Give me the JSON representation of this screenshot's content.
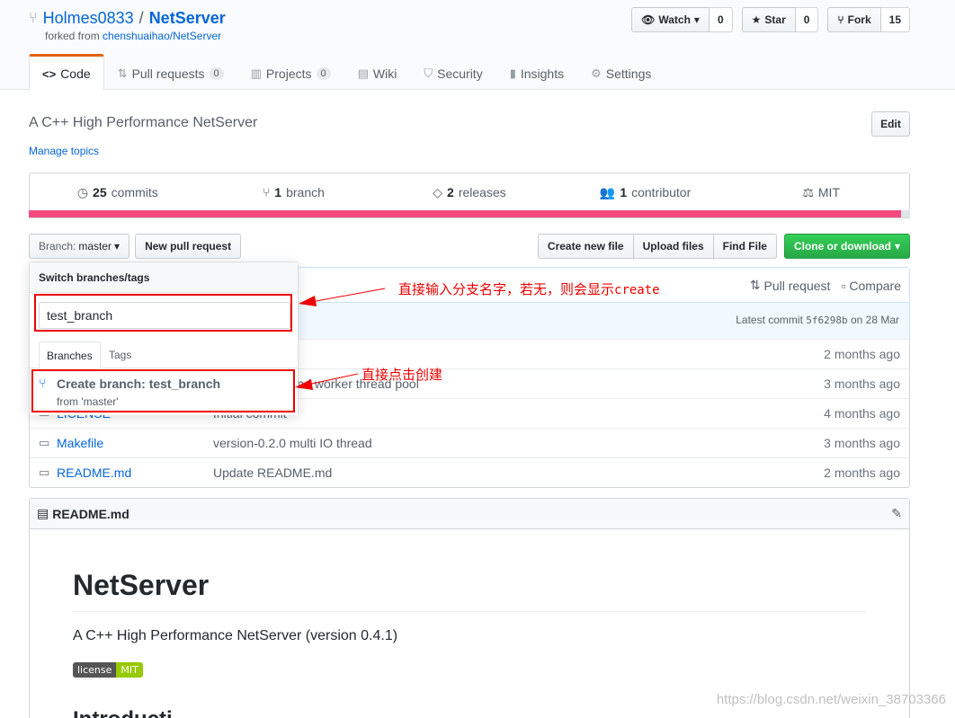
{
  "repo": {
    "owner": "Holmes0833",
    "separator": "/",
    "name": "NetServer",
    "forked_prefix": "forked from ",
    "forked_from": "chenshuaihao/NetServer"
  },
  "actions": {
    "watch": {
      "label": "Watch",
      "count": "0"
    },
    "star": {
      "label": "Star",
      "count": "0"
    },
    "fork": {
      "label": "Fork",
      "count": "15"
    }
  },
  "tabs": [
    {
      "label": "Code",
      "icon": "code-icon",
      "counter": ""
    },
    {
      "label": "Pull requests",
      "icon": "pull-request-icon",
      "counter": "0"
    },
    {
      "label": "Projects",
      "icon": "project-icon",
      "counter": "0"
    },
    {
      "label": "Wiki",
      "icon": "book-icon",
      "counter": ""
    },
    {
      "label": "Security",
      "icon": "shield-icon",
      "counter": ""
    },
    {
      "label": "Insights",
      "icon": "graph-icon",
      "counter": ""
    },
    {
      "label": "Settings",
      "icon": "gear-icon",
      "counter": ""
    }
  ],
  "description": "A C++ High Performance NetServer",
  "manage_topics": "Manage topics",
  "edit_label": "Edit",
  "summary": {
    "commits_num": "25",
    "commits_label": "commits",
    "branches_num": "1",
    "branches_label": "branch",
    "releases_num": "2",
    "releases_label": "releases",
    "contributors_num": "1",
    "contributors_label": "contributor",
    "license": "MIT"
  },
  "file_nav": {
    "branch_prefix": "Branch:",
    "branch_name": "master",
    "new_pr": "New pull request",
    "create_file": "Create new file",
    "upload_files": "Upload files",
    "find_file": "Find File",
    "clone": "Clone or download"
  },
  "commit_tease": {
    "pull_request": "Pull request",
    "compare": "Compare",
    "latest_prefix": "Latest commit",
    "sha": "5f6298b",
    "date": "on 28 Mar"
  },
  "files": [
    {
      "name": "",
      "message": "",
      "age": "2 months ago"
    },
    {
      "name": "",
      "message": "...d IO thread and worker thread pool",
      "age": "3 months ago"
    },
    {
      "name": "LICENSE",
      "message": "Initial commit",
      "age": "4 months ago"
    },
    {
      "name": "Makefile",
      "message": "version-0.2.0 multi IO thread",
      "age": "3 months ago"
    },
    {
      "name": "README.md",
      "message": "Update README.md",
      "age": "2 months ago"
    }
  ],
  "readme": {
    "file": "README.md",
    "h1": "NetServer",
    "intro": "A C++ High Performance NetServer (version 0.4.1)",
    "badge_left": "license",
    "badge_right": "MIT",
    "h2": "Introducti"
  },
  "branch_menu": {
    "header": "Switch branches/tags",
    "filter_value": "test_branch",
    "tab_branches": "Branches",
    "tab_tags": "Tags",
    "create_title": "Create branch: test_branch",
    "create_from": "from 'master'"
  },
  "annotations": {
    "top_text": "直接输入分支名字，若无，则会显示",
    "top_code": "create",
    "bottom_text": "直接点击创建"
  },
  "watermark": "https://blog.csdn.net/weixin_38703366",
  "colors": {
    "accent_tab": "#e36209",
    "language_bar": "#f34b7d",
    "clone_button": "#28a745",
    "annotation_red": "#e00000"
  }
}
